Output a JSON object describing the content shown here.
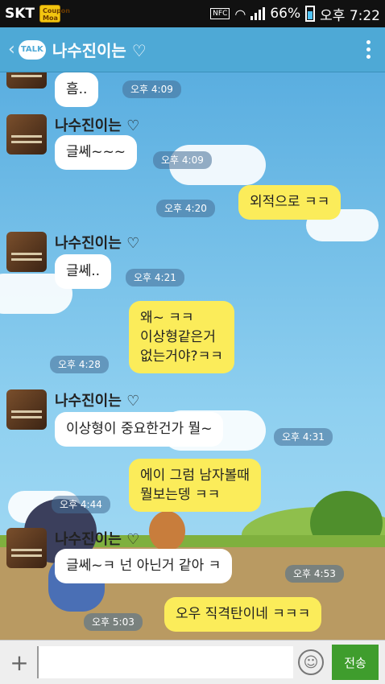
{
  "status_bar": {
    "carrier": "SKT",
    "coupon": "Coupon Moa",
    "nfc": "NFC",
    "battery": "66%",
    "time": "오후 7:22"
  },
  "header": {
    "logo": "TALK",
    "title": "나수진이는 ♡"
  },
  "messages": [
    {
      "from": "in",
      "text": "흠..",
      "time": "오후 4:09"
    },
    {
      "from": "in",
      "sender": "나수진이는 ♡",
      "text": "글쎄~~~",
      "time": "오후 4:09"
    },
    {
      "from": "out",
      "text": "외적으로 ㅋㅋ",
      "time": "오후 4:20"
    },
    {
      "from": "in",
      "sender": "나수진이는 ♡",
      "text": "글쎄..",
      "time": "오후 4:21"
    },
    {
      "from": "out",
      "lines": [
        "왜~ ㅋㅋ",
        "이상형같은거",
        "없는거야?ㅋㅋ"
      ],
      "time": "오후 4:28"
    },
    {
      "from": "in",
      "sender": "나수진이는 ♡",
      "text": "이상형이 중요한건가 뭘~",
      "time": "오후 4:31"
    },
    {
      "from": "out",
      "lines": [
        "에이 그럼 남자볼때",
        "뭘보는뎅 ㅋㅋ"
      ],
      "time": "오후 4:44"
    },
    {
      "from": "in",
      "sender": "나수진이는 ♡",
      "text": "글쎄~ㅋ 넌 아닌거 같아 ㅋ",
      "time": "오후 4:53"
    },
    {
      "from": "out",
      "text": "오우 직격탄이네 ㅋㅋㅋ",
      "time": "오후 5:03"
    }
  ],
  "input": {
    "plus": "+",
    "value": "",
    "send_label": "전송"
  }
}
